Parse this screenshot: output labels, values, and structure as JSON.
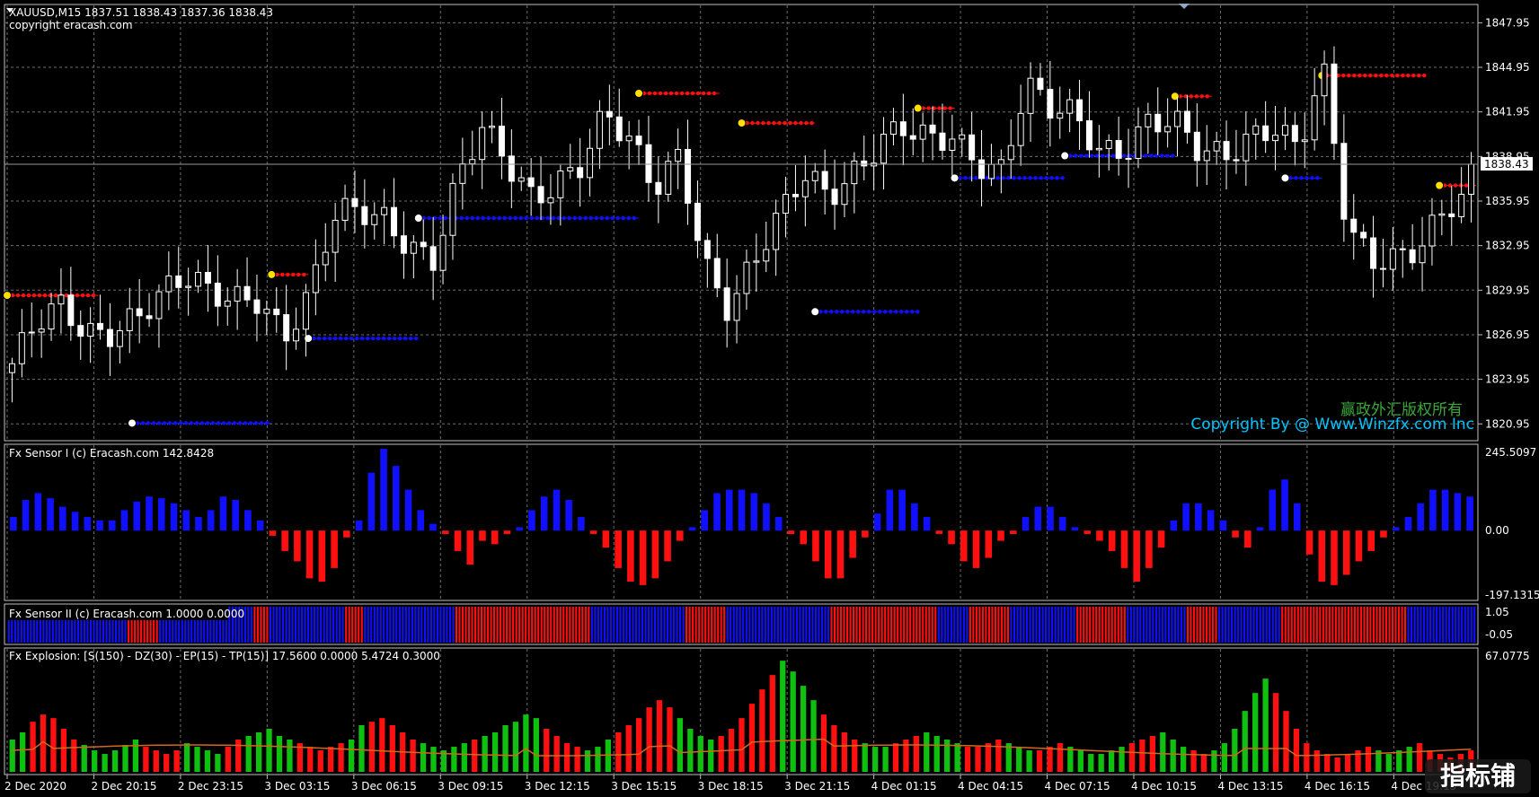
{
  "main": {
    "header": "XAUUSD,M15  1837.51 1838.43 1837.36 1838.43",
    "copyright": "copyright eracash.com",
    "price_label": "1838.43",
    "watermark_cn": "赢政外汇版权所有",
    "watermark_en": "Copyright By @ Www.Winzfx.com Inc",
    "y_ticks": [
      "1847.95",
      "1844.95",
      "1841.95",
      "1838.95",
      "1835.95",
      "1832.95",
      "1829.95",
      "1826.95",
      "1823.95",
      "1820.95"
    ]
  },
  "sensor1": {
    "title": "Fx Sensor I (c) Eracash.com 142.8428",
    "y_ticks": [
      "245.5097",
      "0.00",
      "-197.1315"
    ]
  },
  "sensor2": {
    "title": "Fx Sensor II (c) Eracash.com 1.0000 0.0000",
    "y_ticks": [
      "1.05",
      "-0.05"
    ]
  },
  "explosion": {
    "title": "Fx Explosion: [S(150) - DZ(30) - EP(15) - TP(15)] 17.5600 0.0000 5.4724 0.3000",
    "y_ticks": [
      "67.0775"
    ]
  },
  "x_ticks": [
    "2 Dec 2020",
    "2 Dec 20:15",
    "2 Dec 23:15",
    "3 Dec 03:15",
    "3 Dec 06:15",
    "3 Dec 09:15",
    "3 Dec 12:15",
    "3 Dec 15:15",
    "3 Dec 18:15",
    "3 Dec 21:15",
    "4 Dec 01:15",
    "4 Dec 04:15",
    "4 Dec 07:15",
    "4 Dec 10:15",
    "4 Dec 13:15",
    "4 Dec 16:15",
    "4 Dec 19:15"
  ],
  "logo_text": "指标铺",
  "colors": {
    "bull": "#1010ff",
    "bear": "#ff1010",
    "green": "#10c010",
    "ma": "#d2691e",
    "grid": "#6e6e6e"
  },
  "chart_data": {
    "type": "candlestick",
    "symbol": "XAUUSD",
    "timeframe": "M15",
    "ylim": [
      1820.0,
      1849.0
    ],
    "x_labels": [
      "2 Dec 2020",
      "2 Dec 20:15",
      "2 Dec 23:15",
      "3 Dec 03:15",
      "3 Dec 06:15",
      "3 Dec 09:15",
      "3 Dec 12:15",
      "3 Dec 15:15",
      "3 Dec 18:15",
      "3 Dec 21:15",
      "4 Dec 01:15",
      "4 Dec 04:15",
      "4 Dec 07:15",
      "4 Dec 10:15",
      "4 Dec 13:15",
      "4 Dec 16:15",
      "4 Dec 19:15"
    ],
    "last": {
      "open": 1837.51,
      "high": 1838.43,
      "low": 1837.36,
      "close": 1838.43
    },
    "close_anchors": [
      1825.0,
      1827.5,
      1828.5,
      1827.0,
      1827.5,
      1828.5,
      1829.5,
      1830.5,
      1829.5,
      1829.5,
      1829.8,
      1827.0,
      1829.3,
      1834.5,
      1835.2,
      1835.0,
      1833.5,
      1832.0,
      1837.0,
      1840.5,
      1838.5,
      1836.5,
      1837.5,
      1838.5,
      1841.5,
      1839.5,
      1836.8,
      1839.5,
      1832.0,
      1828.5,
      1831.5,
      1834.5,
      1838.0,
      1836.8,
      1838.0,
      1839.5,
      1840.5,
      1839.8,
      1840.5,
      1839.0,
      1838.2,
      1843.5,
      1841.8,
      1841.5,
      1839.5,
      1839.8,
      1841.5,
      1841.0,
      1838.9,
      1838.8,
      1840.5,
      1841.5,
      1839.5,
      1844.5,
      1833.5,
      1832.0,
      1832.5,
      1833.5,
      1835.5,
      1836.0
    ],
    "sensor1": {
      "ylim": [
        -197.1315,
        245.5097
      ],
      "values": [
        40,
        90,
        110,
        95,
        70,
        55,
        40,
        30,
        30,
        60,
        85,
        100,
        95,
        80,
        60,
        40,
        60,
        100,
        90,
        60,
        30,
        -15,
        -60,
        -90,
        -140,
        -150,
        -110,
        -20,
        30,
        170,
        240,
        190,
        120,
        60,
        20,
        -10,
        -60,
        -100,
        -30,
        -40,
        -10,
        10,
        60,
        100,
        120,
        90,
        40,
        -10,
        -50,
        -110,
        -150,
        -160,
        -140,
        -90,
        -30,
        10,
        60,
        110,
        120,
        120,
        110,
        80,
        40,
        -10,
        -40,
        -90,
        -140,
        -140,
        -80,
        -20,
        50,
        120,
        120,
        80,
        40,
        -10,
        -40,
        -90,
        -110,
        -80,
        -30,
        -10,
        40,
        70,
        70,
        40,
        10,
        -10,
        -30,
        -60,
        -110,
        -150,
        -110,
        -50,
        30,
        80,
        80,
        60,
        30,
        -20,
        -50,
        10,
        120,
        150,
        80,
        -70,
        -150,
        -160,
        -130,
        -90,
        -60,
        -20,
        10,
        40,
        80,
        120,
        120,
        110,
        100
      ]
    },
    "sensor2": {
      "ylim": [
        -0.05,
        1.05
      ],
      "state_sequence": "BBBBBBBBBBBBBBBBBBBBBBBBBBBBBBBBBBBBBBRRRRRRRRRRBBBBBBBBBBBBBBBBBBBBBBBBBBBBBBRRRRRBBBBBBBBBBBBBBBBBBBBBBBBRRRRRRBBBBBBBBBBBBBBBBBBBBBBBBBBBBBRRRRRRRRRRRRRRRRRRRRRRRRRRRRRRRRRRRRRRRRRRRBBBBBBBBBBBBBBBBBBBBBBBBBBBBBBRRRRRRRRRRRRRBBBBBBBBBBBBBBBBBBBBBBBBBBBBBBBBBRRRRRRRRRRRRRRRRRRRRRRRRRRRRRRRRRRBBBBBBBBBBRRRRRRRRRRRRRBBBBBBBBBBBBBBBBBBBBBRRRRRRRRRRRRRRRRBBBBBBBBBBBBBBBBBBBRRRRRRRRRRBBBBBBBBBBBBBBBBBBBBRRRRRRRRRRRRRRRRRRRRRRRRRRRRRRRRRRRRRRRRBBBBBBBBBBBBBBBBBBBBBB"
    },
    "explosion": {
      "ylim": [
        0,
        67.0775
      ],
      "values": [
        18,
        22,
        28,
        32,
        30,
        24,
        18,
        15,
        12,
        10,
        12,
        15,
        18,
        14,
        12,
        10,
        12,
        16,
        14,
        12,
        10,
        14,
        18,
        20,
        22,
        24,
        20,
        18,
        16,
        14,
        12,
        14,
        16,
        18,
        26,
        28,
        30,
        26,
        22,
        18,
        16,
        14,
        12,
        14,
        16,
        18,
        20,
        22,
        26,
        28,
        32,
        30,
        24,
        20,
        16,
        14,
        12,
        14,
        18,
        22,
        26,
        30,
        36,
        40,
        36,
        30,
        24,
        20,
        18,
        20,
        24,
        30,
        38,
        46,
        54,
        62,
        56,
        48,
        40,
        32,
        26,
        22,
        18,
        16,
        14,
        14,
        16,
        18,
        20,
        22,
        20,
        18,
        16,
        14,
        14,
        16,
        18,
        16,
        14,
        12,
        12,
        14,
        16,
        14,
        12,
        10,
        10,
        12,
        14,
        16,
        18,
        20,
        22,
        18,
        14,
        12,
        10,
        12,
        16,
        24,
        34,
        44,
        52,
        44,
        34,
        24,
        16,
        12,
        10,
        8,
        10,
        12,
        14,
        12,
        10,
        12,
        14,
        16,
        12,
        10,
        8,
        10,
        12
      ],
      "ma_level": 12
    },
    "trailing_stops": {
      "red_segments": [
        [
          0,
          0.062,
          1829.6
        ],
        [
          0.18,
          0.205,
          1831.0
        ],
        [
          0.43,
          0.485,
          1843.2
        ],
        [
          0.5,
          0.55,
          1841.2
        ],
        [
          0.62,
          0.645,
          1842.2
        ],
        [
          0.795,
          0.82,
          1843.0
        ],
        [
          0.895,
          0.965,
          1844.4
        ],
        [
          0.975,
          1.0,
          1837.0
        ]
      ],
      "blue_segments": [
        [
          0.085,
          0.18,
          1821.0
        ],
        [
          0.205,
          0.28,
          1826.7
        ],
        [
          0.28,
          0.43,
          1834.8
        ],
        [
          0.55,
          0.62,
          1828.5
        ],
        [
          0.645,
          0.72,
          1837.5
        ],
        [
          0.72,
          0.795,
          1839.0
        ],
        [
          0.87,
          0.895,
          1837.5
        ]
      ]
    }
  }
}
